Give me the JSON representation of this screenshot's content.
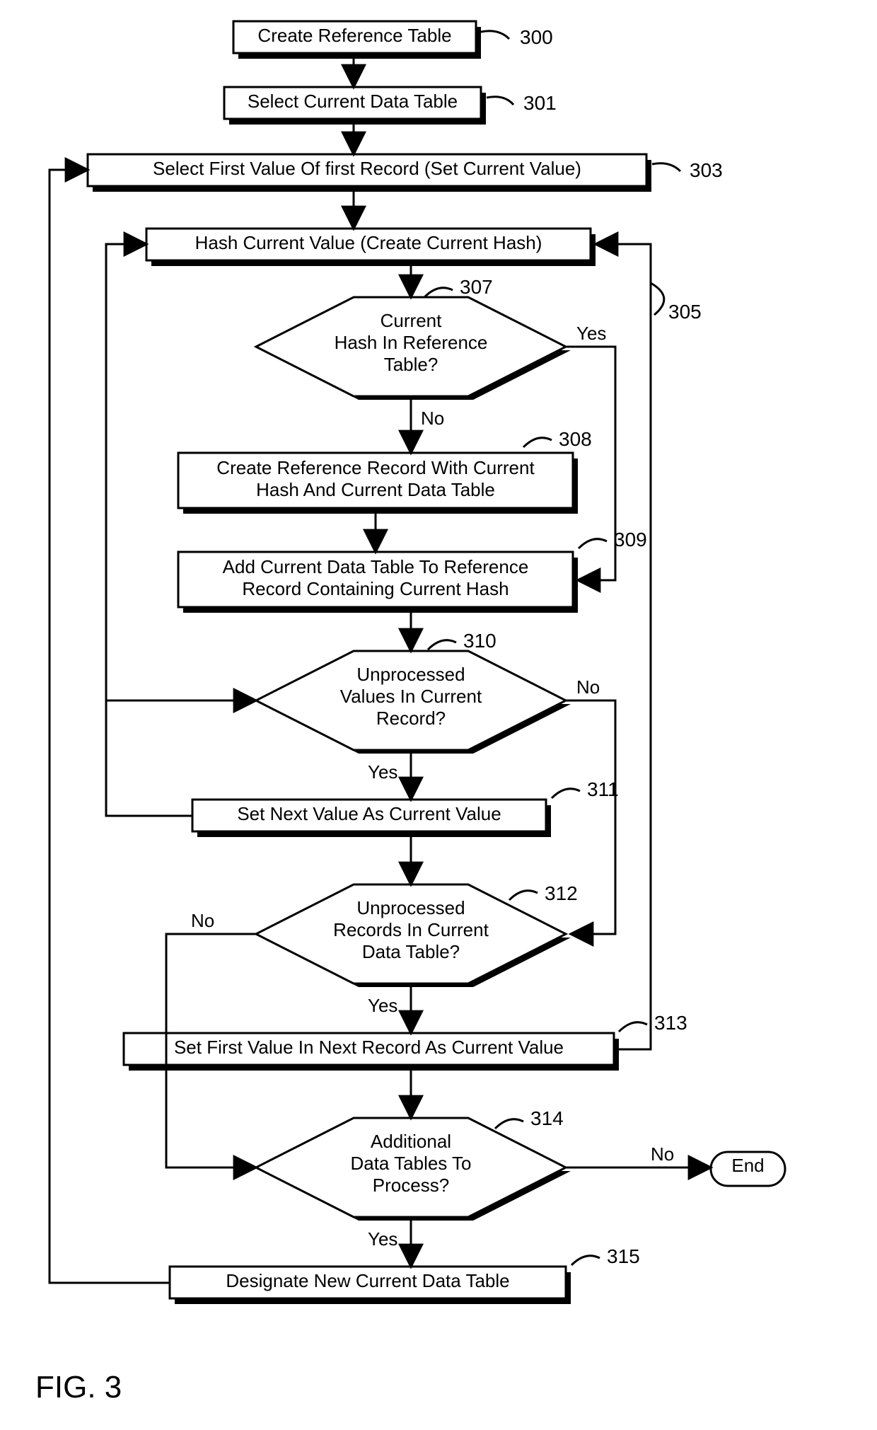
{
  "figure_label": "FIG. 3",
  "nodes": {
    "n300": {
      "ref": "300",
      "text": "Create Reference Table"
    },
    "n301": {
      "ref": "301",
      "text": "Select Current Data Table"
    },
    "n303": {
      "ref": "303",
      "text": "Select First Value Of first Record (Set Current Value)"
    },
    "n305": {
      "ref": "305",
      "text": "Hash Current Value (Create Current Hash)"
    },
    "n307": {
      "ref": "307",
      "text1": "Current",
      "text2": "Hash In Reference",
      "text3": "Table?"
    },
    "n308": {
      "ref": "308",
      "text1": "Create Reference Record With Current",
      "text2": "Hash And Current Data Table"
    },
    "n309": {
      "ref": "309",
      "text1": "Add Current Data Table To Reference",
      "text2": "Record Containing Current Hash"
    },
    "n310": {
      "ref": "310",
      "text1": "Unprocessed",
      "text2": "Values In Current",
      "text3": "Record?"
    },
    "n311": {
      "ref": "311",
      "text": "Set Next Value As Current Value"
    },
    "n312": {
      "ref": "312",
      "text1": "Unprocessed",
      "text2": "Records In Current",
      "text3": "Data Table?"
    },
    "n313": {
      "ref": "313",
      "text": "Set First Value In Next Record As Current Value"
    },
    "n314": {
      "ref": "314",
      "text1": "Additional",
      "text2": "Data Tables To",
      "text3": "Process?"
    },
    "n315": {
      "ref": "315",
      "text": "Designate New Current Data Table"
    },
    "end": {
      "text": "End"
    }
  },
  "edges": {
    "e307_yes": "Yes",
    "e307_no": "No",
    "e310_yes": "Yes",
    "e310_no": "No",
    "e312_yes": "Yes",
    "e312_no": "No",
    "e314_yes": "Yes",
    "e314_no": "No"
  }
}
